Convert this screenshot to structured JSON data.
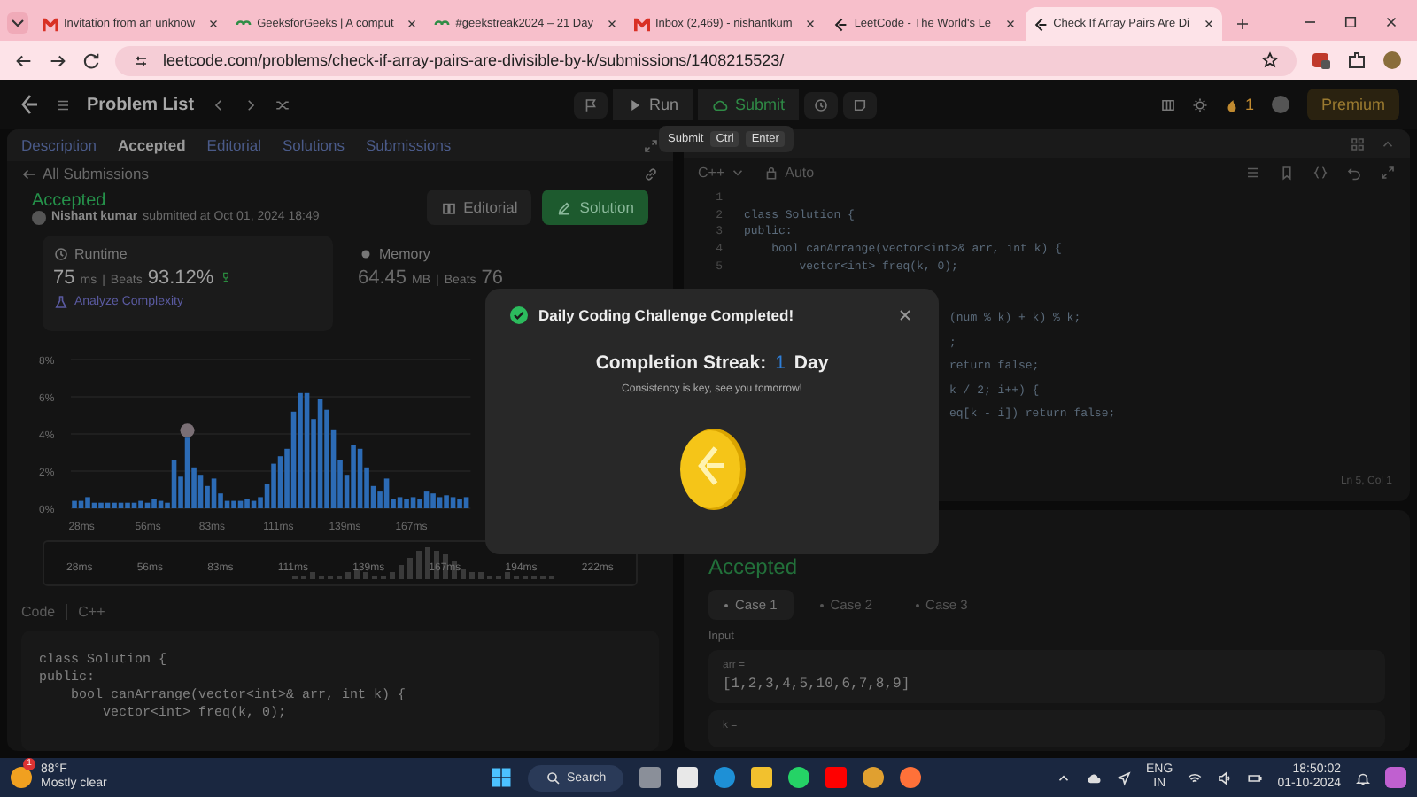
{
  "browser": {
    "tabs": [
      {
        "title": "Invitation from an unknow",
        "kind": "mail",
        "selected": false
      },
      {
        "title": "GeeksforGeeks | A comput",
        "kind": "gfg",
        "selected": false
      },
      {
        "title": "#geekstreak2024 – 21 Day",
        "kind": "gfg",
        "selected": false
      },
      {
        "title": "Inbox (2,469) - nishantkum",
        "kind": "mail",
        "selected": false
      },
      {
        "title": "LeetCode - The World's Le",
        "kind": "lc",
        "selected": false
      },
      {
        "title": "Check If Array Pairs Are Di",
        "kind": "lc",
        "selected": true
      }
    ],
    "url": "leetcode.com/problems/check-if-array-pairs-are-divisible-by-k/submissions/1408215523/"
  },
  "nav": {
    "problem_list": "Problem List",
    "run": "Run",
    "submit": "Submit",
    "streak": "1",
    "premium": "Premium"
  },
  "tooltip": [
    "Submit",
    "Ctrl",
    "Enter"
  ],
  "left": {
    "tabs": [
      {
        "label": "Description",
        "selected": false
      },
      {
        "label": "Accepted",
        "selected": true
      },
      {
        "label": "Editorial",
        "selected": false
      },
      {
        "label": "Solutions",
        "selected": false
      },
      {
        "label": "Submissions",
        "selected": false
      }
    ],
    "back": "All Submissions",
    "status": "Accepted",
    "user": "Nishant kumar",
    "submitted": "submitted at Oct 01, 2024 18:49",
    "buttons": [
      "Editorial",
      "Solution"
    ],
    "runtime": {
      "label": "Runtime",
      "value": "75",
      "unit": "ms",
      "sep": "|",
      "beats": "Beats",
      "percent": "93.12%",
      "analyze": "Analyze Complexity"
    },
    "memory": {
      "label": "Memory",
      "value": "64.45",
      "unit": "MB",
      "sep": "|",
      "beats": "Beats",
      "percent": "76"
    },
    "chart_data": {
      "type": "bar",
      "grid": true,
      "xlim": [
        23.5,
        192
      ],
      "ylim": [
        0,
        8
      ],
      "yticks": [
        {
          "value": 0,
          "label": "0%"
        },
        {
          "value": 2,
          "label": "2%"
        },
        {
          "value": 4,
          "label": "4%"
        },
        {
          "value": 6,
          "label": "6%"
        },
        {
          "value": 8,
          "label": "8%"
        }
      ],
      "xticks": [
        {
          "value": 28,
          "label": "28ms"
        },
        {
          "value": 56,
          "label": "56ms"
        },
        {
          "value": 83,
          "label": "83ms"
        },
        {
          "value": 111,
          "label": "111ms"
        },
        {
          "value": 139,
          "label": "139ms"
        },
        {
          "value": 167,
          "label": "167ms"
        }
      ],
      "x": [
        25,
        27.8,
        30.6,
        33.4,
        36.2,
        39,
        41.8,
        44.6,
        47.4,
        50.2,
        53,
        55.8,
        58.6,
        61.4,
        64.2,
        67,
        69.8,
        72.6,
        75.4,
        78.2,
        81,
        83.8,
        86.6,
        89.4,
        92.2,
        95,
        97.8,
        100.6,
        103.4,
        106.2,
        109,
        111.8,
        114.6,
        117.4,
        120.2,
        123,
        125.8,
        128.6,
        131.4,
        134.2,
        137,
        139.8,
        142.6,
        145.4,
        148.2,
        151,
        153.8,
        156.6,
        159.4,
        162.2,
        165,
        167.8,
        170.6,
        173.4,
        176.2,
        179,
        181.8,
        184.6,
        187.4,
        190.2
      ],
      "values": [
        0.4,
        0.4,
        0.6,
        0.3,
        0.3,
        0.3,
        0.3,
        0.3,
        0.3,
        0.3,
        0.4,
        0.3,
        0.5,
        0.4,
        0.3,
        2.6,
        1.7,
        3.8,
        2.2,
        1.8,
        1.2,
        1.6,
        0.8,
        0.4,
        0.4,
        0.4,
        0.5,
        0.4,
        0.6,
        1.3,
        2.4,
        2.8,
        3.2,
        5.2,
        6.2,
        6.2,
        4.8,
        5.9,
        5.3,
        4.2,
        2.6,
        1.8,
        3.4,
        3.2,
        2.2,
        1.2,
        0.9,
        1.6,
        0.5,
        0.6,
        0.5,
        0.6,
        0.5,
        0.9,
        0.8,
        0.6,
        0.7,
        0.6,
        0.5,
        0.6
      ]
    },
    "minimap_labels": [
      "28ms",
      "56ms",
      "83ms",
      "111ms",
      "139ms",
      "167ms",
      "194ms",
      "222ms"
    ],
    "code_label": "Code",
    "code_lang": "C++",
    "code": [
      "class Solution {",
      "public:",
      "    bool canArrange(vector<int>& arr, int k) {",
      "        vector<int> freq(k, 0);"
    ]
  },
  "editor": {
    "lang": "C++",
    "mode": "Auto",
    "lines": [
      {
        "n": "1"
      },
      {
        "n": "2",
        "text": "class Solution {"
      },
      {
        "n": "3",
        "text": "public:"
      },
      {
        "n": "4",
        "text": "    bool canArrange(vector<int>& arr, int k) {"
      },
      {
        "n": "5",
        "text": "        vector<int> freq(k, 0);"
      }
    ],
    "fragments": [
      "(num % k) + k) % k;",
      ";",
      "return false;",
      "k / 2; i++) {",
      "eq[k - i]) return false;"
    ],
    "position": "Ln 5, Col 1"
  },
  "result": {
    "status": "Accepted",
    "cases": [
      {
        "label": "Case 1",
        "selected": true
      },
      {
        "label": "Case 2",
        "selected": false
      },
      {
        "label": "Case 3",
        "selected": false
      }
    ],
    "input_label": "Input",
    "params": [
      {
        "name": "arr =",
        "value": "[1,2,3,4,5,10,6,7,8,9]"
      },
      {
        "name": "k ="
      }
    ]
  },
  "modal": {
    "title": "Daily Coding Challenge Completed!",
    "streak_label": "Completion Streak:",
    "streak": "1",
    "streak_unit": "Day",
    "message": "Consistency is key, see you tomorrow!"
  },
  "taskbar": {
    "temp": "88°F",
    "weather": "Mostly clear",
    "badge": "1",
    "search": "Search",
    "lang": "ENG",
    "region": "IN",
    "time": "18:50:02",
    "date": "01-10-2024"
  }
}
